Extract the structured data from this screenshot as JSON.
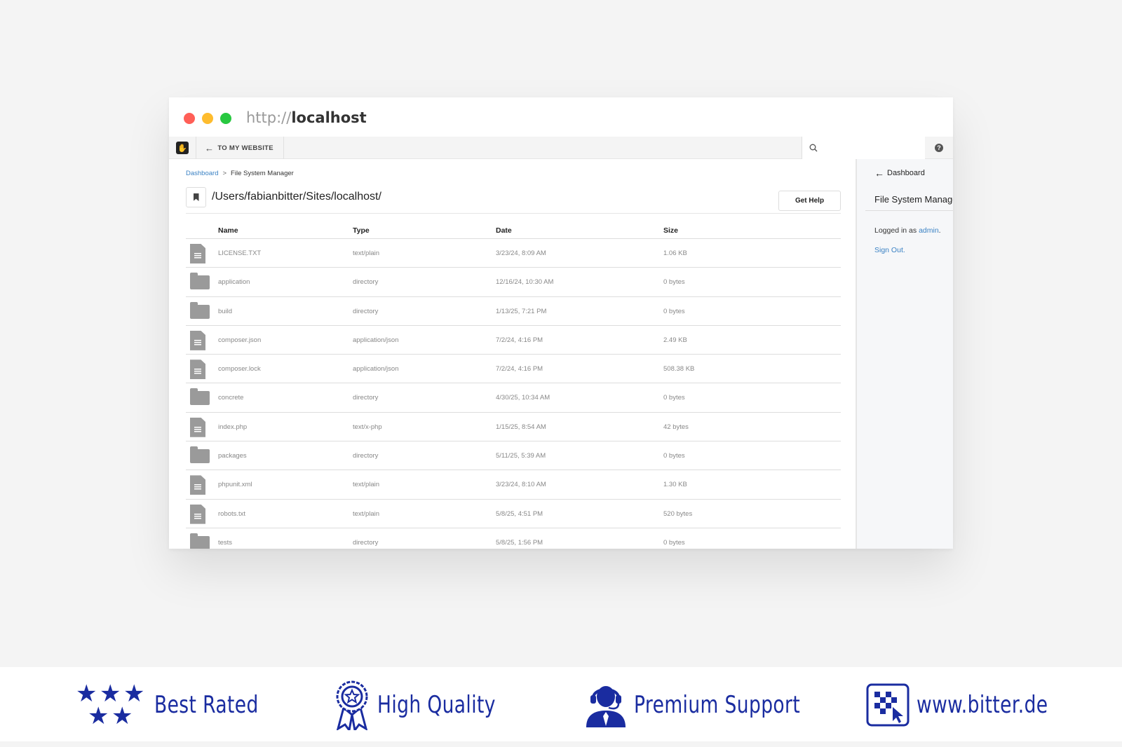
{
  "browser": {
    "url_protocol": "http://",
    "url_host": "localhost"
  },
  "toolbar": {
    "back_label": "TO MY WEBSITE",
    "search_placeholder": ""
  },
  "breadcrumb": {
    "root": "Dashboard",
    "separator": ">",
    "current": "File System Manager"
  },
  "path": "/Users/fabianbitter/Sites/localhost/",
  "get_help_label": "Get Help",
  "table": {
    "columns": [
      "Name",
      "Type",
      "Date",
      "Size"
    ],
    "rows": [
      {
        "icon": "file",
        "name": "LICENSE.TXT",
        "type": "text/plain",
        "date": "3/23/24, 8:09 AM",
        "size": "1.06 KB"
      },
      {
        "icon": "folder",
        "name": "application",
        "type": "directory",
        "date": "12/16/24, 10:30 AM",
        "size": "0 bytes"
      },
      {
        "icon": "folder",
        "name": "build",
        "type": "directory",
        "date": "1/13/25, 7:21 PM",
        "size": "0 bytes"
      },
      {
        "icon": "file",
        "name": "composer.json",
        "type": "application/json",
        "date": "7/2/24, 4:16 PM",
        "size": "2.49 KB"
      },
      {
        "icon": "file",
        "name": "composer.lock",
        "type": "application/json",
        "date": "7/2/24, 4:16 PM",
        "size": "508.38 KB"
      },
      {
        "icon": "folder",
        "name": "concrete",
        "type": "directory",
        "date": "4/30/25, 10:34 AM",
        "size": "0 bytes"
      },
      {
        "icon": "file",
        "name": "index.php",
        "type": "text/x-php",
        "date": "1/15/25, 8:54 AM",
        "size": "42 bytes"
      },
      {
        "icon": "folder",
        "name": "packages",
        "type": "directory",
        "date": "5/11/25, 5:39 AM",
        "size": "0 bytes"
      },
      {
        "icon": "file",
        "name": "phpunit.xml",
        "type": "text/plain",
        "date": "3/23/24, 8:10 AM",
        "size": "1.30 KB"
      },
      {
        "icon": "file",
        "name": "robots.txt",
        "type": "text/plain",
        "date": "5/8/25, 4:51 PM",
        "size": "520 bytes"
      },
      {
        "icon": "folder",
        "name": "tests",
        "type": "directory",
        "date": "5/8/25, 1:56 PM",
        "size": "0 bytes"
      }
    ]
  },
  "side_panel": {
    "back_label": "Dashboard",
    "title": "File System Manager",
    "logged_in_prefix": "Logged in as",
    "logged_in_user": "admin",
    "logged_in_suffix": ".",
    "sign_out": "Sign Out."
  },
  "footer": {
    "badges": [
      {
        "icon": "stars-icon",
        "label": "Best Rated"
      },
      {
        "icon": "medal-icon",
        "label": "High Quality"
      },
      {
        "icon": "support-agent-icon",
        "label": "Premium Support"
      },
      {
        "icon": "bitter-logo-icon",
        "label": "www.bitter.de"
      }
    ],
    "accent_color": "#1a2ca0"
  },
  "colors": {
    "link": "#3b82c4",
    "close_dot": "#ff5f57",
    "minimize_dot": "#febc2e",
    "maximize_dot": "#28c840"
  }
}
